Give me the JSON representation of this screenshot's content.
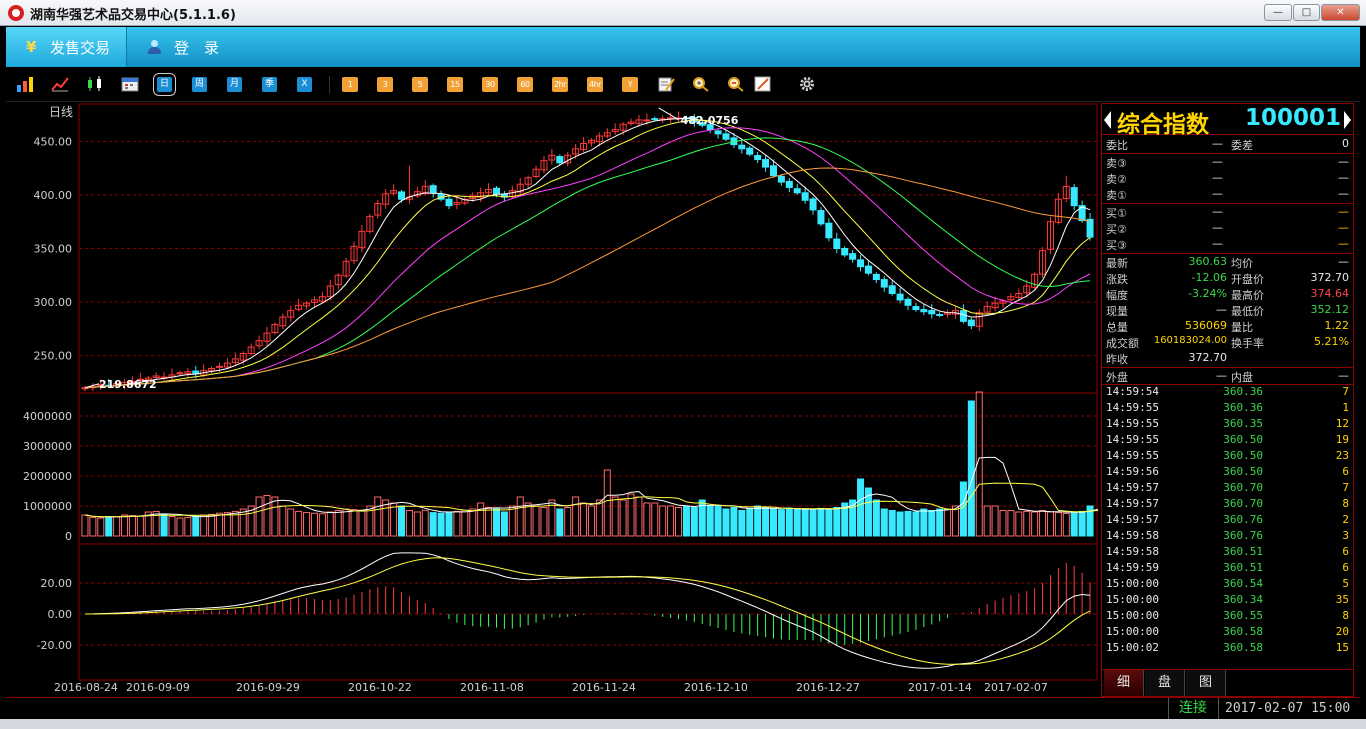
{
  "window": {
    "title": "湖南华强艺术品交易中心(5.1.1.6)",
    "minimize": "—",
    "maximize": "□",
    "close": "✕"
  },
  "menubar": {
    "tabs": [
      {
        "label": "发售交易",
        "icon": "yen-icon"
      },
      {
        "label": "登　录",
        "icon": "user-icon"
      }
    ]
  },
  "toolbar": {
    "periods": [
      "日",
      "周",
      "月",
      "季",
      "X"
    ],
    "minutes": [
      "1",
      "3",
      "5",
      "15",
      "30",
      "60",
      "2hr",
      "4hr",
      "Y"
    ],
    "icons": [
      "bar-chart-icon",
      "line-chart-icon",
      "candle-chart-icon",
      "calendar-icon",
      "edit-icon",
      "zoom-in-icon",
      "zoom-out-icon",
      "draw-icon",
      "settings-icon"
    ]
  },
  "chart_data": [
    {
      "type": "candlestick",
      "title": "日线",
      "ylim": [
        217,
        483
      ],
      "yticks": [
        "450.00",
        "400.00",
        "350.00",
        "300.00",
        "250.00"
      ],
      "xticks": [
        "2016-08-24",
        "2016-09-09",
        "2016-09-29",
        "2016-10-22",
        "2016-11-08",
        "2016-11-24",
        "2016-12-10",
        "2016-12-27",
        "2017-01-14",
        "2017-02-07"
      ],
      "high_label": "482.0756",
      "low_label": "219.8672",
      "close": [
        220,
        221,
        223,
        222,
        224,
        225,
        226,
        228,
        229,
        231,
        230,
        232,
        234,
        235,
        233,
        236,
        238,
        240,
        243,
        247,
        252,
        258,
        264,
        271,
        279,
        286,
        292,
        297,
        299,
        302,
        305,
        315,
        325,
        338,
        352,
        366,
        380,
        392,
        401,
        404,
        396,
        398,
        403,
        408,
        402,
        396,
        390,
        393,
        396,
        399,
        402,
        405,
        401,
        398,
        404,
        410,
        416,
        424,
        432,
        437,
        430,
        437,
        443,
        448,
        451,
        455,
        458,
        461,
        466,
        468,
        470,
        470,
        471,
        471,
        472,
        472,
        471,
        468,
        465,
        461,
        457,
        452,
        447,
        443,
        438,
        433,
        426,
        418,
        412,
        407,
        402,
        395,
        386,
        373,
        360,
        350,
        344,
        340,
        333,
        327,
        321,
        314,
        308,
        302,
        297,
        293,
        291,
        289,
        288,
        290,
        292,
        282,
        278,
        290,
        296,
        299,
        301,
        305,
        308,
        315,
        326,
        348,
        375,
        396,
        408,
        390,
        376,
        360.63
      ],
      "ma_colors": {
        "ma5": "#ffffff",
        "ma10": "#ffff44",
        "ma20": "#ff40ff",
        "ma30": "#33ff55",
        "ma60": "#ff9a3a"
      }
    },
    {
      "type": "bar",
      "title": "volume",
      "yticks": [
        "4000000",
        "3000000",
        "2000000",
        "1000000",
        "0"
      ],
      "ylim": [
        0,
        4700000
      ],
      "values": [
        700000,
        620000,
        600000,
        650000,
        640000,
        700000,
        680000,
        660000,
        800000,
        820000,
        720000,
        650000,
        600000,
        620000,
        660000,
        700000,
        720000,
        760000,
        780000,
        820000,
        900000,
        1000000,
        1300000,
        1350000,
        1300000,
        1000000,
        900000,
        820000,
        780000,
        760000,
        740000,
        800000,
        850000,
        900000,
        880000,
        860000,
        1000000,
        1300000,
        1200000,
        1100000,
        1000000,
        850000,
        800000,
        860000,
        780000,
        760000,
        800000,
        820000,
        860000,
        900000,
        1100000,
        950000,
        900000,
        800000,
        1000000,
        1300000,
        1100000,
        1000000,
        950000,
        1200000,
        900000,
        950000,
        1300000,
        1100000,
        1000000,
        1200000,
        2200000,
        1300000,
        1200000,
        1400000,
        1300000,
        1100000,
        1100000,
        1000000,
        1000000,
        950000,
        1000000,
        950000,
        1200000,
        1000000,
        1000000,
        900000,
        950000,
        850000,
        900000,
        1000000,
        950000,
        900000,
        880000,
        920000,
        900000,
        880000,
        900000,
        920000,
        900000,
        950000,
        1100000,
        1200000,
        1900000,
        1600000,
        1200000,
        900000,
        850000,
        800000,
        820000,
        800000,
        900000,
        850000,
        900000,
        900000,
        1000000,
        1800000,
        4500000,
        4800000,
        1000000,
        1000000,
        850000,
        850000,
        800000,
        820000,
        800000,
        850000,
        800000,
        780000,
        750000,
        800000,
        820000,
        1000000,
        1100000
      ]
    },
    {
      "type": "line",
      "title": "macd",
      "yticks": [
        "20.00",
        "0.00",
        "-20.00"
      ],
      "ylim": [
        -42,
        44
      ]
    }
  ],
  "side": {
    "name": "综合指数",
    "code": "100001",
    "weibi_label": "委比",
    "weibi_val": "—",
    "weicha_label": "委差",
    "weicha_val": "0",
    "asks": [
      {
        "label": "卖③",
        "p": "—",
        "v": "—"
      },
      {
        "label": "卖②",
        "p": "—",
        "v": "—"
      },
      {
        "label": "卖①",
        "p": "—",
        "v": "—"
      }
    ],
    "bids": [
      {
        "label": "买①",
        "p": "—",
        "v": "—"
      },
      {
        "label": "买②",
        "p": "—",
        "v": "—"
      },
      {
        "label": "买③",
        "p": "—",
        "v": "—"
      }
    ],
    "stats": {
      "latest_label": "最新",
      "latest": "360.63",
      "avg_label": "均价",
      "avg": "—",
      "chg_label": "涨跌",
      "chg": "-12.06",
      "open_label": "开盘价",
      "open": "372.70",
      "amp_label": "幅度",
      "amp": "-3.24%",
      "high_label": "最高价",
      "high": "374.64",
      "cur_label": "现量",
      "cur": "—",
      "low_label": "最低价",
      "low": "352.12",
      "vol_label": "总量",
      "vol": "536069",
      "ratio_label": "量比",
      "ratio": "1.22",
      "amt_label": "成交额",
      "amt": "160183024.00",
      "turn_label": "换手率",
      "turn": "5.21%",
      "prev_label": "昨收",
      "prev": "372.70"
    },
    "outer_label": "外盘",
    "outer": "—",
    "inner_label": "内盘",
    "inner": "—",
    "trades": [
      {
        "t": "14:59:54",
        "p": "360.36",
        "v": "7"
      },
      {
        "t": "14:59:55",
        "p": "360.36",
        "v": "1"
      },
      {
        "t": "14:59:55",
        "p": "360.35",
        "v": "12"
      },
      {
        "t": "14:59:55",
        "p": "360.50",
        "v": "19"
      },
      {
        "t": "14:59:55",
        "p": "360.50",
        "v": "23"
      },
      {
        "t": "14:59:56",
        "p": "360.50",
        "v": "6"
      },
      {
        "t": "14:59:57",
        "p": "360.70",
        "v": "7"
      },
      {
        "t": "14:59:57",
        "p": "360.70",
        "v": "8"
      },
      {
        "t": "14:59:57",
        "p": "360.76",
        "v": "2"
      },
      {
        "t": "14:59:58",
        "p": "360.76",
        "v": "3"
      },
      {
        "t": "14:59:58",
        "p": "360.51",
        "v": "6"
      },
      {
        "t": "14:59:59",
        "p": "360.51",
        "v": "6"
      },
      {
        "t": "15:00:00",
        "p": "360.54",
        "v": "5"
      },
      {
        "t": "15:00:00",
        "p": "360.34",
        "v": "35"
      },
      {
        "t": "15:00:00",
        "p": "360.55",
        "v": "8"
      },
      {
        "t": "15:00:00",
        "p": "360.58",
        "v": "20"
      },
      {
        "t": "15:00:02",
        "p": "360.58",
        "v": "15"
      }
    ],
    "tabs": [
      "细",
      "盘",
      "图"
    ]
  },
  "status": {
    "connection": "连接",
    "datetime": "2017-02-07 15:00"
  }
}
